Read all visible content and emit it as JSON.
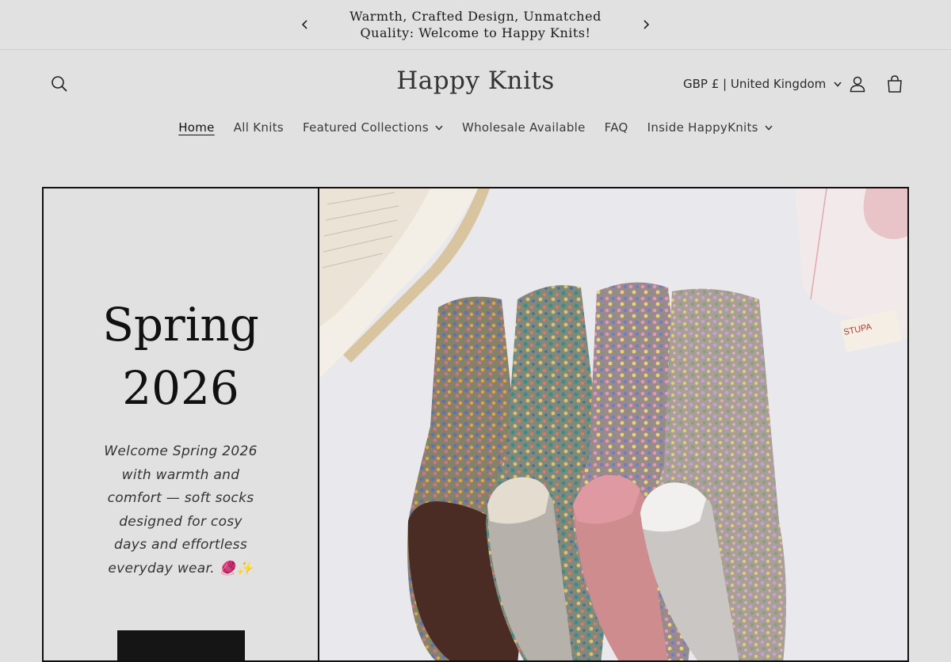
{
  "announcement": {
    "text": "Warmth, Crafted Design, Unmatched Quality: Welcome to Happy Knits!",
    "prev_icon": "chevron-left-icon",
    "next_icon": "chevron-right-icon"
  },
  "header": {
    "logo": "Happy Knits",
    "search_icon": "search-icon",
    "currency": "GBP £ | United Kingdom",
    "account_icon": "user-icon",
    "cart_icon": "cart-icon"
  },
  "nav": {
    "items": [
      {
        "label": "Home",
        "active": true,
        "dropdown": false
      },
      {
        "label": "All Knits",
        "active": false,
        "dropdown": false
      },
      {
        "label": "Featured Collections",
        "active": false,
        "dropdown": true
      },
      {
        "label": "Wholesale Available",
        "active": false,
        "dropdown": false
      },
      {
        "label": "FAQ",
        "active": false,
        "dropdown": false
      },
      {
        "label": "Inside HappyKnits",
        "active": false,
        "dropdown": true
      }
    ]
  },
  "hero": {
    "title": "Spring 2026",
    "description": "Welcome Spring 2026 with warmth and comfort — soft socks designed for cosy days and effortless everyday wear. 🧶✨",
    "button_label": "",
    "image_alt": "Four pairs of floral knit socks with an open book and a pink mug",
    "book_stamp": "STUPA"
  },
  "colors": {
    "background": "#e1e1e1",
    "text": "#1f1f1f",
    "button": "#151515",
    "border": "#111111"
  }
}
